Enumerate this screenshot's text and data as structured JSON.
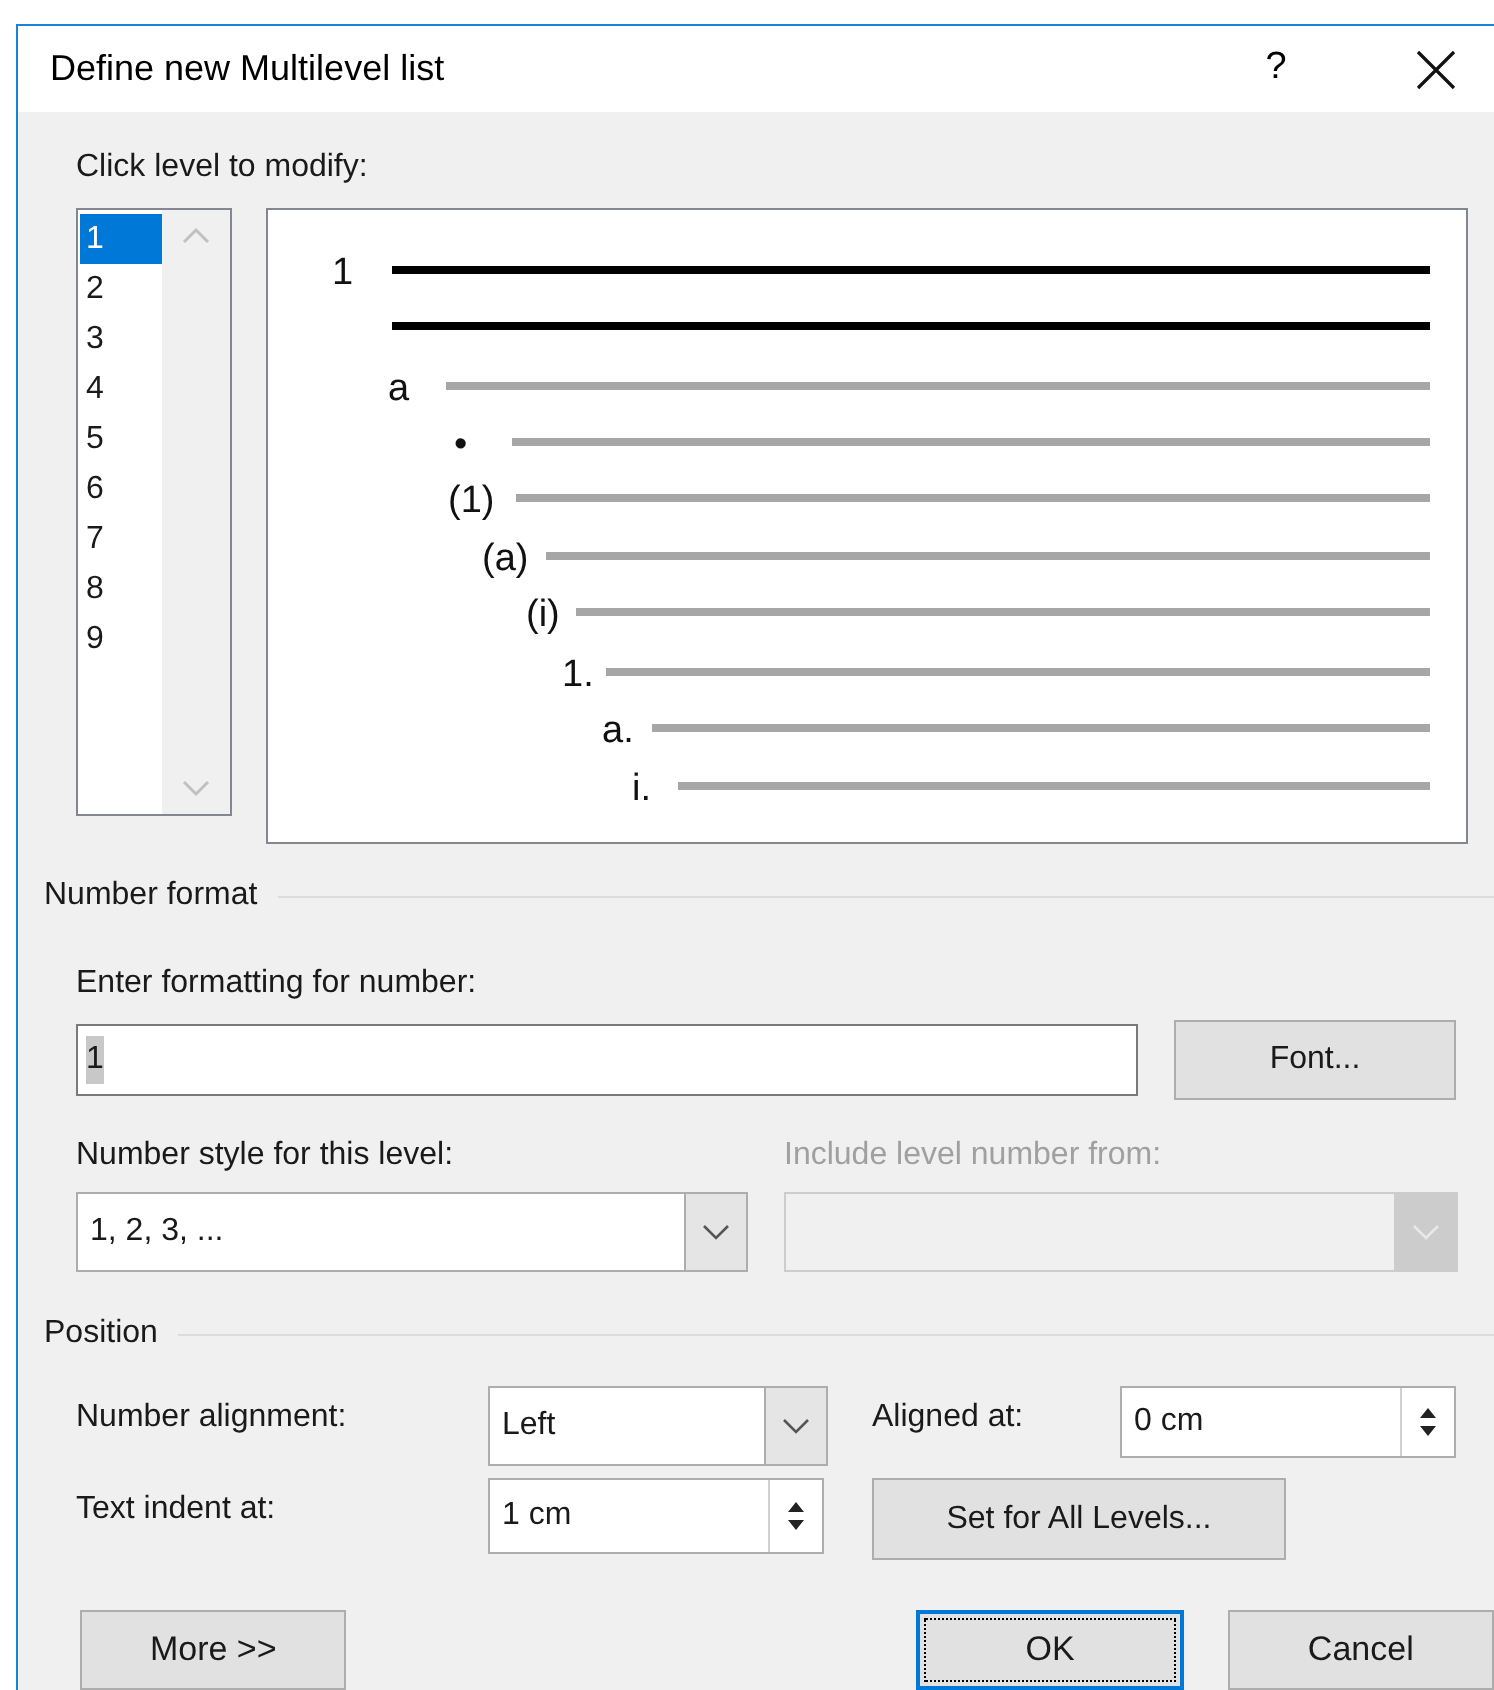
{
  "window": {
    "title": "Define new Multilevel list",
    "help": "?"
  },
  "level_picker": {
    "label": {
      "text": "Click level to modify:"
    },
    "levels": [
      {
        "label": "1",
        "selected": true
      },
      {
        "label": "2",
        "selected": false
      },
      {
        "label": "3",
        "selected": false
      },
      {
        "label": "4",
        "selected": false
      },
      {
        "label": "5",
        "selected": false
      },
      {
        "label": "6",
        "selected": false
      },
      {
        "label": "7",
        "selected": false
      },
      {
        "label": "8",
        "selected": false
      },
      {
        "label": "9",
        "selected": false
      }
    ]
  },
  "preview": {
    "levels": [
      {
        "number": "1",
        "kind": "primary"
      },
      {
        "number": "a",
        "kind": "secondary"
      },
      {
        "number": "•",
        "kind": "secondary"
      },
      {
        "number": "(1)",
        "kind": "secondary"
      },
      {
        "number": "(a)",
        "kind": "secondary"
      },
      {
        "number": "(i)",
        "kind": "secondary"
      },
      {
        "number": "1.",
        "kind": "secondary"
      },
      {
        "number": "a.",
        "kind": "secondary"
      },
      {
        "number": "i.",
        "kind": "secondary"
      }
    ]
  },
  "number_format": {
    "heading": "Number format",
    "format_label": {
      "text": "Enter formatting for number:"
    },
    "format_value": "1",
    "value_selected": true,
    "font_button": {
      "text": "Font..."
    },
    "style_label": {
      "text": "Number style for this level:"
    },
    "style_value": "1, 2, 3, ...",
    "include_label": {
      "text": "Include level number from:"
    },
    "include_disabled": true
  },
  "position": {
    "heading": "Position",
    "alignment_label": {
      "text": "Number alignment:"
    },
    "alignment_value": "Left",
    "aligned_at_label": {
      "text": "Aligned at:"
    },
    "aligned_at_value": "0 cm",
    "indent_label": {
      "text": "Text indent at:"
    },
    "indent_value": "1 cm",
    "set_all_button": {
      "text": "Set for All Levels..."
    }
  },
  "buttons": [
    {
      "text": "More >>",
      "default": false
    },
    {
      "text": "OK",
      "default": true
    },
    {
      "text": "Cancel",
      "default": false
    }
  ]
}
